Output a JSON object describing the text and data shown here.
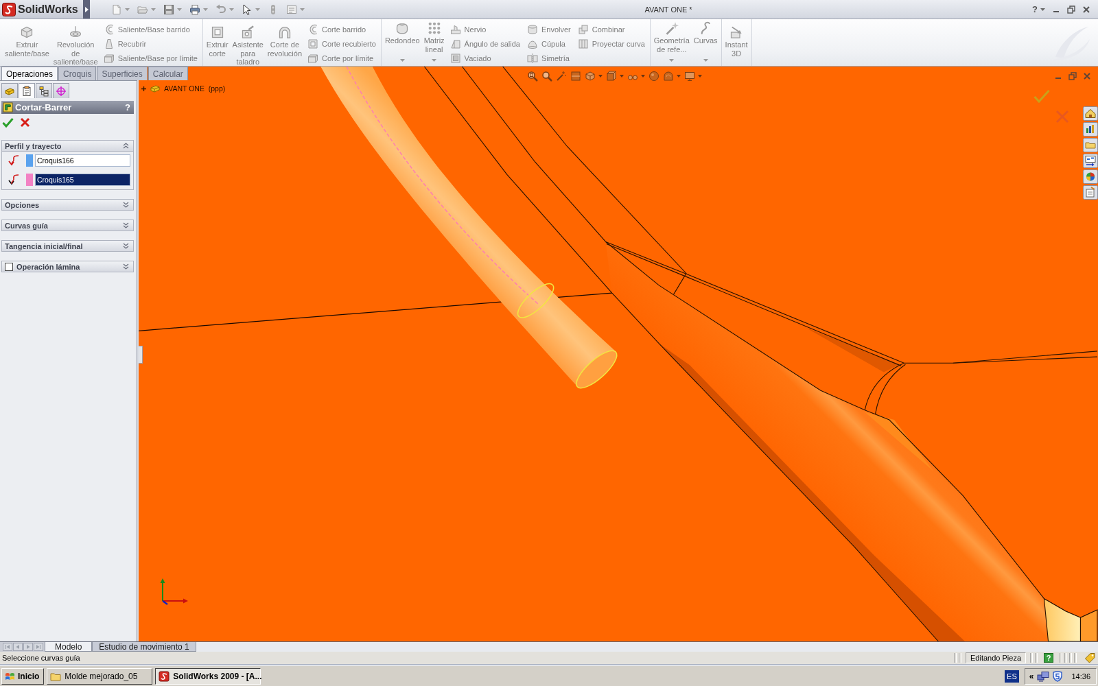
{
  "title_bar": {
    "app_name": "SolidWorks",
    "document_title": "AVANT ONE *",
    "help": "?"
  },
  "ribbon": {
    "groups": [
      {
        "columns": [
          {
            "kind": "large",
            "label": "Extruir\nsaliente/base",
            "menu": false,
            "disabled": true
          },
          {
            "kind": "large",
            "label": "Revolución\nde\nsaliente/base",
            "menu": false,
            "disabled": true
          },
          {
            "kind": "stack",
            "items": [
              {
                "label": "Saliente/Base barrido",
                "disabled": true
              },
              {
                "label": "Recubrir",
                "disabled": true
              },
              {
                "label": "Saliente/Base por límite",
                "disabled": true
              }
            ]
          }
        ]
      },
      {
        "columns": [
          {
            "kind": "large",
            "label": "Extruir\ncorte",
            "menu": false,
            "disabled": true
          },
          {
            "kind": "large",
            "label": "Asistente\npara\ntaladro",
            "menu": false,
            "disabled": true
          },
          {
            "kind": "large",
            "label": "Corte de\nrevolución",
            "menu": false,
            "disabled": true
          },
          {
            "kind": "stack",
            "items": [
              {
                "label": "Corte barrido",
                "disabled": true
              },
              {
                "label": "Corte recubierto",
                "disabled": true
              },
              {
                "label": "Corte por límite",
                "disabled": true
              }
            ]
          }
        ]
      },
      {
        "columns": [
          {
            "kind": "large",
            "label": "Redondeo",
            "menu": true,
            "disabled": true
          },
          {
            "kind": "large",
            "label": "Matriz\nlineal",
            "menu": true,
            "disabled": true
          },
          {
            "kind": "stack",
            "items": [
              {
                "label": "Nervio",
                "disabled": true
              },
              {
                "label": "Ángulo de salida",
                "disabled": true
              },
              {
                "label": "Vaciado",
                "disabled": true
              }
            ]
          },
          {
            "kind": "stack",
            "items": [
              {
                "label": "Envolver",
                "disabled": true
              },
              {
                "label": "Cúpula",
                "disabled": true
              },
              {
                "label": "Simetría",
                "disabled": true
              }
            ]
          },
          {
            "kind": "stack",
            "items": [
              {
                "label": "Combinar",
                "disabled": true
              },
              {
                "label": "Proyectar curva",
                "disabled": true
              }
            ]
          }
        ]
      },
      {
        "columns": [
          {
            "kind": "large",
            "label": "Geometría\nde refe...",
            "menu": true,
            "disabled": true
          },
          {
            "kind": "large",
            "label": "Curvas",
            "menu": true,
            "disabled": true
          }
        ]
      },
      {
        "columns": [
          {
            "kind": "large",
            "label": "Instant\n3D",
            "menu": false,
            "disabled": true
          }
        ]
      }
    ]
  },
  "command_tabs": [
    {
      "label": "Operaciones",
      "selected": true
    },
    {
      "label": "Croquis",
      "selected": false
    },
    {
      "label": "Superficies",
      "selected": false
    },
    {
      "label": "Calcular",
      "selected": false
    }
  ],
  "manager_tabs": [
    {
      "kind": "feature_tree",
      "selected": false
    },
    {
      "kind": "property",
      "selected": true
    },
    {
      "kind": "configuration",
      "selected": false
    },
    {
      "kind": "dimxpert",
      "selected": false
    }
  ],
  "property_manager": {
    "title": "Cortar-Barrer",
    "help": "?",
    "sections": [
      {
        "title": "Perfil y trayecto",
        "expanded": true,
        "rows": [
          {
            "value": "Croquis166",
            "color": "#5aa2ee",
            "selected": false
          },
          {
            "value": "Croquis165",
            "color": "#f282c4",
            "selected": true
          }
        ]
      },
      {
        "title": "Opciones",
        "expanded": false
      },
      {
        "title": "Curvas guía",
        "expanded": false
      },
      {
        "title": "Tangencia inicial/final",
        "expanded": false
      },
      {
        "title": "Operación lámina",
        "expanded": false,
        "checkbox": {
          "checked": false
        }
      }
    ]
  },
  "feature_flyout": {
    "label": "AVANT ONE  (ppp)",
    "expanded": false
  },
  "model_tabs": [
    {
      "label": "Modelo",
      "selected": true
    },
    {
      "label": "Estudio de movimiento 1",
      "selected": false
    }
  ],
  "status_bar": {
    "message": "Seleccione curvas guía",
    "mode": "Editando Pieza",
    "help": "?"
  },
  "taskbar": {
    "start": "Inicio",
    "tasks": [
      {
        "label": "Molde mejorado_05",
        "kind": "folder",
        "selected": false
      },
      {
        "label": "SolidWorks 2009 - [A...",
        "kind": "app",
        "selected": true
      }
    ],
    "language": "ES",
    "tray_toggle": "«",
    "clock": "14:36"
  }
}
